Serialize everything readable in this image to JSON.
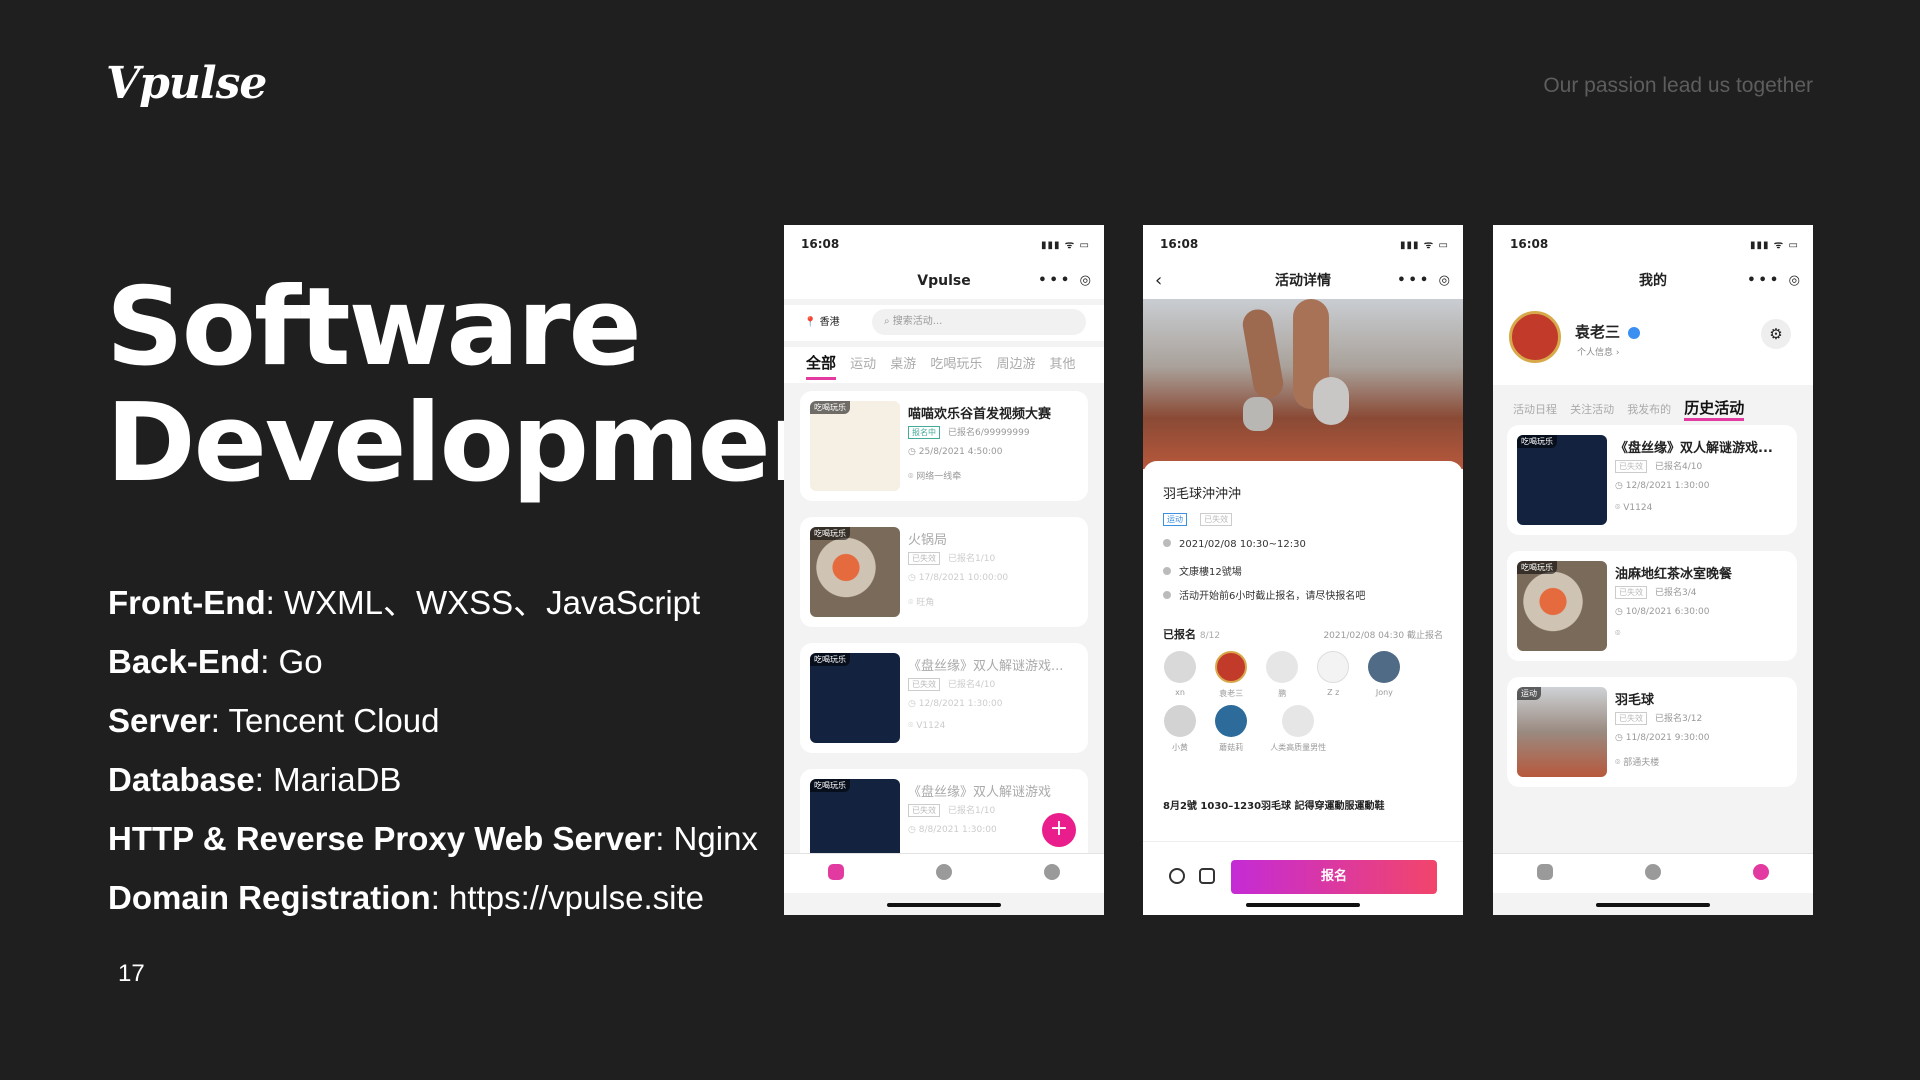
{
  "brand": {
    "logo": "Vpulse",
    "tagline": "Our passion lead us together"
  },
  "title": {
    "line1": "Software",
    "line2": "Development"
  },
  "specs": [
    {
      "key": "Front-End",
      "value": ": WXML、WXSS、JavaScript"
    },
    {
      "key": "Back-End",
      "value": ": Go"
    },
    {
      "key": "Server",
      "value": ": Tencent Cloud"
    },
    {
      "key": "Database",
      "value": ": MariaDB"
    },
    {
      "key": "HTTP & Reverse Proxy Web Server",
      "value": ": Nginx"
    },
    {
      "key": "Domain Registration",
      "value": ": https://vpulse.site"
    }
  ],
  "page_number": "17",
  "phone1": {
    "time": "16:08",
    "status_icons": "▮▮▮ ᯤ ▭",
    "capsule": "•••  ◎",
    "title": "Vpulse",
    "location": "📍 香港",
    "search_placeholder": "搜索活动...",
    "categories": [
      "全部",
      "运动",
      "桌游",
      "吃喝玩乐",
      "周边游",
      "其他"
    ],
    "cards": [
      {
        "tag": "吃喝玩乐",
        "title": "喵喵欢乐谷首发视频大赛",
        "badge": "报名中",
        "count": "已报名6/99999999",
        "time": "25/8/2021 4:50:00",
        "place": "网络一线牵"
      },
      {
        "tag": "吃喝玩乐",
        "title": "火锅局",
        "badge": "已失效",
        "count": "已报名1/10",
        "time": "17/8/2021 10:00:00",
        "place": "旺角"
      },
      {
        "tag": "吃喝玩乐",
        "title": "《盘丝缘》双人解谜游戏...",
        "badge": "已失效",
        "count": "已报名4/10",
        "time": "12/8/2021 1:30:00",
        "place": "V1124"
      },
      {
        "tag": "吃喝玩乐",
        "title": "《盘丝缘》双人解谜游戏",
        "badge": "已失效",
        "count": "已报名1/10",
        "time": "8/8/2021 1:30:00",
        "place": ""
      }
    ],
    "fab": "+"
  },
  "phone2": {
    "time": "16:08",
    "status_icons": "▮▮▮ ᯤ ▭",
    "capsule": "•••  ◎",
    "title": "活动详情",
    "back": "‹",
    "event_title": "羽毛球沖沖沖",
    "badge1": "运动",
    "badge2": "已失效",
    "datetime": "2021/02/08 10:30~12:30",
    "venue": "文康樓12號場",
    "notice": "活动开始前6小时截止报名，请尽快报名吧",
    "signup_label": "已报名",
    "signup_count": "8/12",
    "deadline": "2021/02/08 04:30 截止报名",
    "participants": [
      "xn",
      "袁老三",
      "鹏",
      "Z z",
      "Jony",
      "小黄",
      "蘑菇莉",
      "人类高质量男性"
    ],
    "note": "8月2號 1030–1230羽毛球 記得穿運動服運動鞋",
    "button": "报名"
  },
  "phone3": {
    "time": "16:08",
    "status_icons": "▮▮▮ ᯤ ▭",
    "capsule": "•••  ◎",
    "title": "我的",
    "name": "袁老三",
    "info": "个人信息 ›",
    "gear": "⚙",
    "tabs": [
      "活动日程",
      "关注活动",
      "我发布的",
      "历史活动"
    ],
    "cards": [
      {
        "tag": "吃喝玩乐",
        "title": "《盘丝缘》双人解谜游戏...",
        "badge": "已失效",
        "count": "已报名4/10",
        "time": "12/8/2021 1:30:00",
        "place": "V1124"
      },
      {
        "tag": "吃喝玩乐",
        "title": "油麻地红茶冰室晚餐",
        "badge": "已失效",
        "count": "已报名3/4",
        "time": "10/8/2021 6:30:00",
        "place": ""
      },
      {
        "tag": "运动",
        "title": "羽毛球",
        "badge": "已失效",
        "count": "已报名3/12",
        "time": "11/8/2021 9:30:00",
        "place": "部通夫楼"
      }
    ]
  }
}
